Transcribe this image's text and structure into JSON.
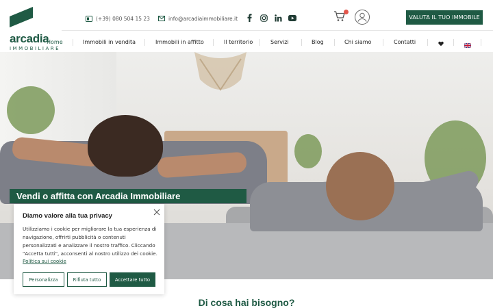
{
  "brand": {
    "name": "arcadia",
    "subtitle": "IMMOBILIARE",
    "color": "#1f5a44"
  },
  "header": {
    "phone": "(+39) 080 504 15 23",
    "email": "info@arcadiaimmobiliare.it",
    "phone_icon": "phone-icon",
    "email_icon": "mail-icon",
    "socials": [
      "facebook-icon",
      "instagram-icon",
      "linkedin-icon",
      "youtube-icon"
    ],
    "cart_icon": "cart-icon",
    "user_icon": "user-icon",
    "cta_label": "VALUTA IL TUO IMMOBILE"
  },
  "nav": {
    "items": [
      {
        "label": "Home",
        "active": true
      },
      {
        "label": "Immobili in vendita"
      },
      {
        "label": "Immobili in affitto"
      },
      {
        "label": "Il territorio"
      },
      {
        "label": "Servizi"
      },
      {
        "label": "Blog"
      },
      {
        "label": "Chi siamo"
      },
      {
        "label": "Contatti"
      }
    ],
    "heart_icon": "heart-icon",
    "flag_icon": "uk-flag-icon"
  },
  "hero": {
    "title": "Vendi o affitta con Arcadia Immobiliare"
  },
  "cookie": {
    "title": "Diamo valore alla tua privacy",
    "text": "Utilizziamo i cookie per migliorare la tua esperienza di navigazione, offrirti pubblicità o contenuti personalizzati e analizzare il nostro traffico. Cliccando \"Accetta tutti\", acconsenti al nostro utilizzo dei cookie.",
    "link": "Politica sui cookie",
    "buttons": {
      "customize": "Personalizza",
      "reject": "Rifiuta tutto",
      "accept": "Accettare tutto"
    }
  },
  "section": {
    "title": "Di cosa hai bisogno?"
  }
}
